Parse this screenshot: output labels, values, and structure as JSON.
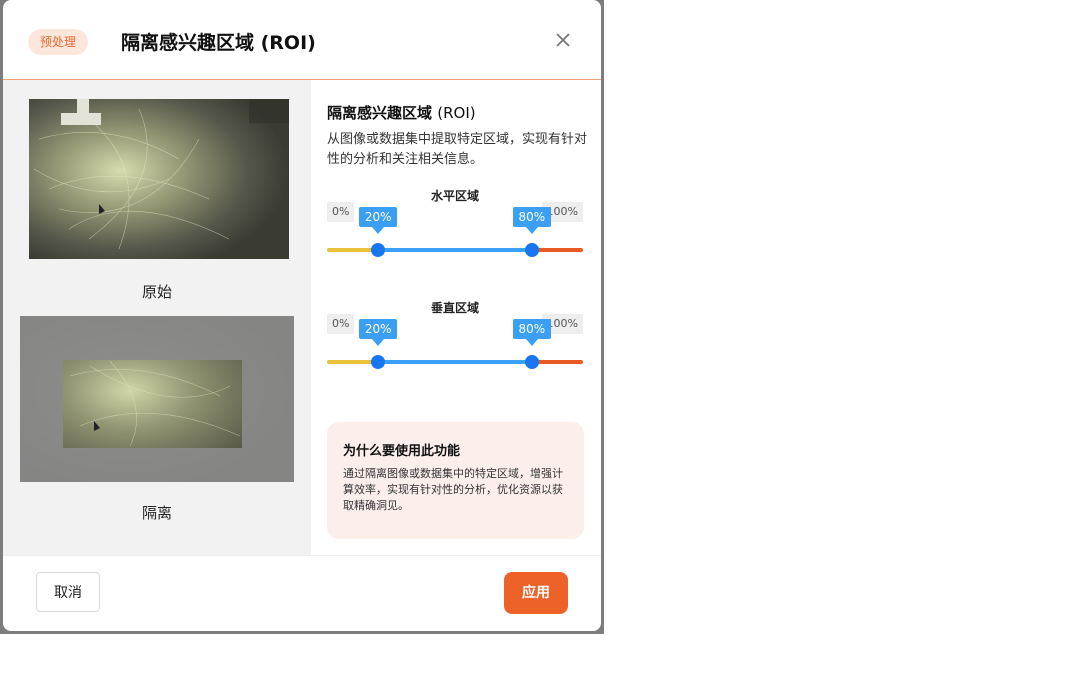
{
  "header": {
    "badge": "预处理",
    "title": "隔离感兴趣区域 (ROI)",
    "close_icon": "close-icon"
  },
  "images": {
    "original_label": "原始",
    "isolated_label": "隔离"
  },
  "panel": {
    "title_main": "隔离感兴趣区域",
    "title_paren": "(ROI)",
    "description": "从图像或数据集中提取特定区域，实现有针对性的分析和关注相关信息。"
  },
  "sliders": {
    "horizontal": {
      "title": "水平区域",
      "min_label": "0%",
      "max_label": "100%",
      "low": 20,
      "high": 80,
      "low_label": "20%",
      "high_label": "80%"
    },
    "vertical": {
      "title": "垂直区域",
      "min_label": "0%",
      "max_label": "100%",
      "low": 20,
      "high": 80,
      "low_label": "20%",
      "high_label": "80%"
    }
  },
  "info": {
    "title": "为什么要使用此功能",
    "text": "通过隔离图像或数据集中的特定区域，增强计算效率，实现有针对性的分析，优化资源以获取精确洞见。"
  },
  "footer": {
    "cancel_label": "取消",
    "apply_label": "应用"
  },
  "colors": {
    "accent": "#ec6228",
    "slider_blue": "#3b9ff5",
    "slider_low": "#e8c23a",
    "slider_high": "#ea5a25"
  }
}
